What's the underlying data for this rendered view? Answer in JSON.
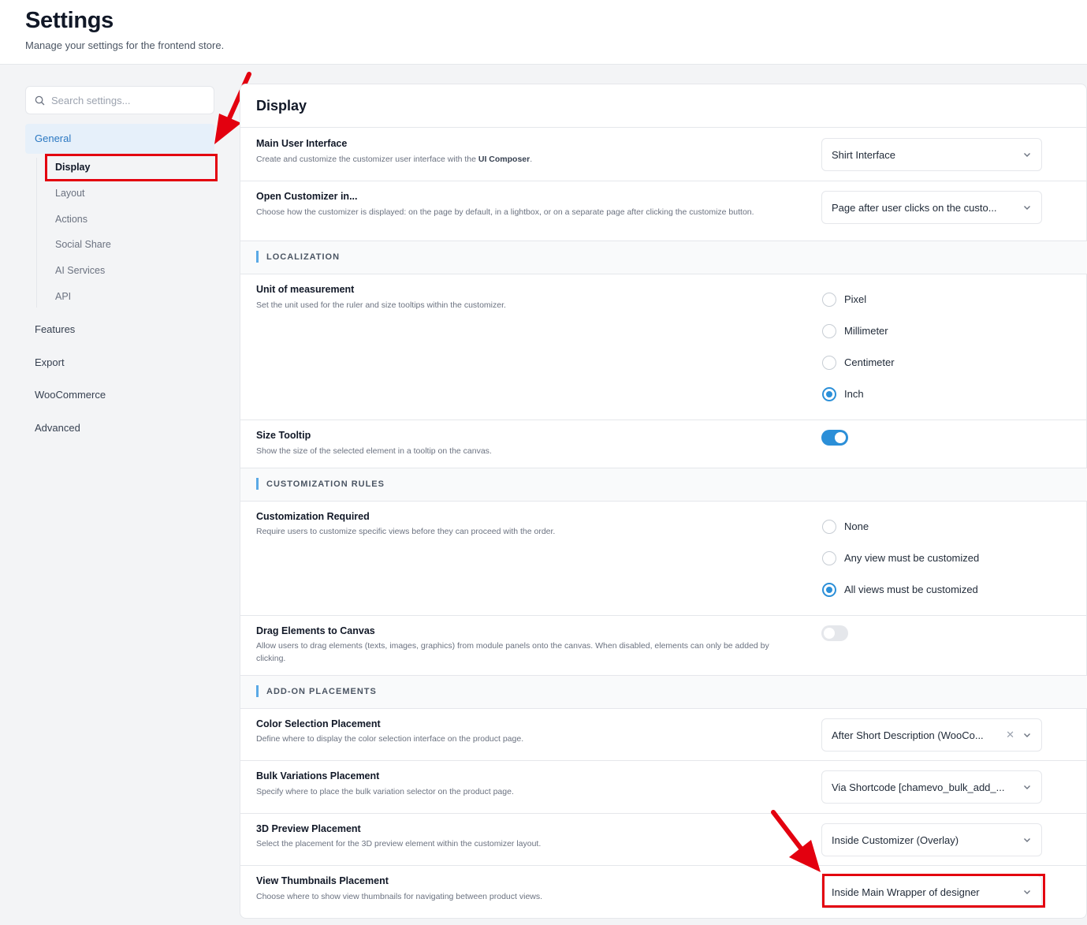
{
  "header": {
    "title": "Settings",
    "subtitle": "Manage your settings for the frontend store."
  },
  "sidebar": {
    "search_placeholder": "Search settings...",
    "general_label": "General",
    "sub_items": [
      "Display",
      "Layout",
      "Actions",
      "Social Share",
      "AI Services",
      "API"
    ],
    "active_sub_item": "Display",
    "items": [
      "Features",
      "Export",
      "WooCommerce",
      "Advanced"
    ]
  },
  "panel": {
    "title": "Display",
    "main_ui": {
      "title": "Main User Interface",
      "desc_before": "Create and customize the customizer user interface with the ",
      "desc_strong": "UI Composer",
      "desc_after": ".",
      "value": "Shirt Interface"
    },
    "open_customizer": {
      "title": "Open Customizer in...",
      "desc": "Choose how the customizer is displayed: on the page by default, in a lightbox, or on a separate page after clicking the customize button.",
      "value": "Page after user clicks on the custo..."
    },
    "section_localization": "LOCALIZATION",
    "unit": {
      "title": "Unit of measurement",
      "desc": "Set the unit used for the ruler and size tooltips within the customizer.",
      "options": [
        "Pixel",
        "Millimeter",
        "Centimeter",
        "Inch"
      ],
      "selected": "Inch"
    },
    "size_tooltip": {
      "title": "Size Tooltip",
      "desc": "Show the size of the selected element in a tooltip on the canvas.",
      "enabled": true
    },
    "section_rules": "CUSTOMIZATION RULES",
    "cust_required": {
      "title": "Customization Required",
      "desc": "Require users to customize specific views before they can proceed with the order.",
      "options": [
        "None",
        "Any view must be customized",
        "All views must be customized"
      ],
      "selected": "All views must be customized"
    },
    "drag_elements": {
      "title": "Drag Elements to Canvas",
      "desc": "Allow users to drag elements (texts, images, graphics) from module panels onto the canvas. When disabled, elements can only be added by clicking.",
      "enabled": false
    },
    "section_addon": "ADD-ON PLACEMENTS",
    "color_sel": {
      "title": "Color Selection Placement",
      "desc": "Define where to display the color selection interface on the product page.",
      "value": "After Short Description (WooCo..."
    },
    "bulk_var": {
      "title": "Bulk Variations Placement",
      "desc": "Specify where to place the bulk variation selector on the product page.",
      "value": "Via Shortcode [chamevo_bulk_add_..."
    },
    "preview_3d": {
      "title": "3D Preview Placement",
      "desc": "Select the placement for the 3D preview element within the customizer layout.",
      "value": "Inside Customizer (Overlay)"
    },
    "view_thumbs": {
      "title": "View Thumbnails Placement",
      "desc": "Choose where to show view thumbnails for navigating between product views.",
      "value": "Inside Main Wrapper of designer"
    }
  },
  "colors": {
    "accent": "#2b8fd8",
    "annotation": "#e3000f",
    "active_nav_bg": "#e6f0fa"
  },
  "icons": {
    "search": "search-icon",
    "chevron": "chevron-down-icon",
    "clear": "close-icon"
  }
}
